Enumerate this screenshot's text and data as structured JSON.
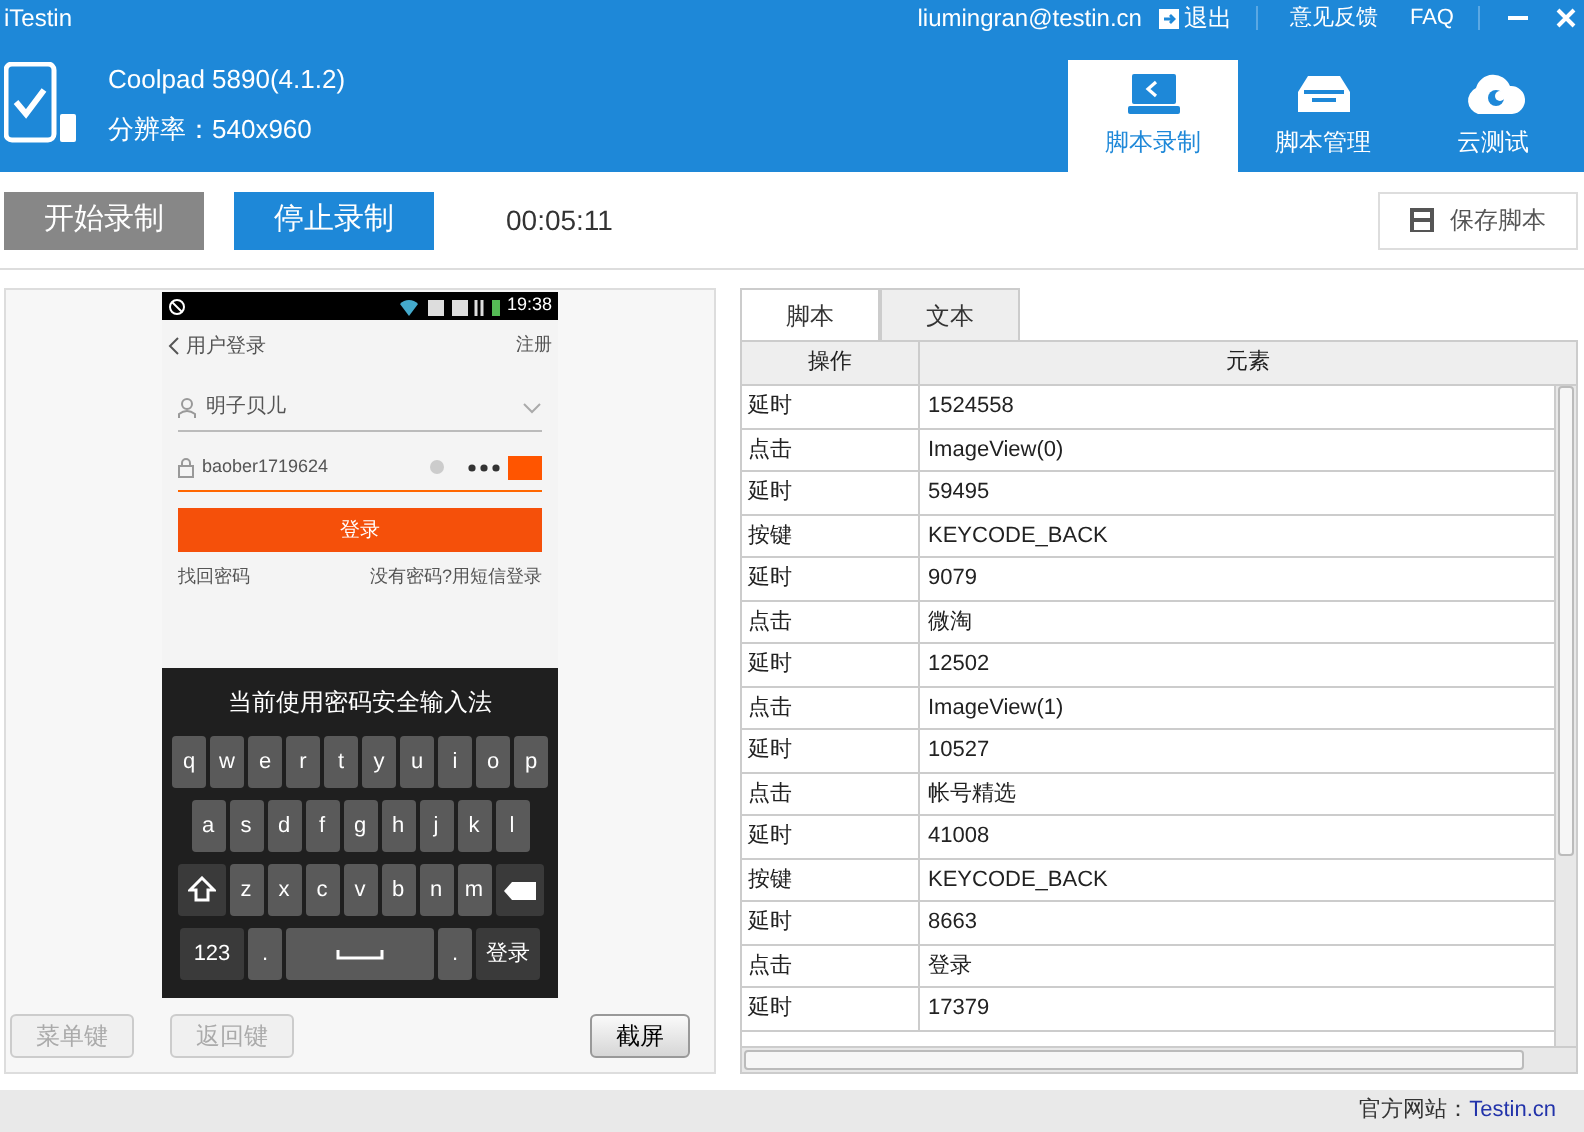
{
  "window": {
    "title": "iTestin",
    "user": "liumingran@testin.cn",
    "logout": "退出",
    "links": [
      "意见反馈",
      "FAQ"
    ]
  },
  "device": {
    "name": "Coolpad 5890(4.1.2)",
    "resolution": "分辨率：540x960"
  },
  "nav_tabs": [
    {
      "label": "脚本录制",
      "kind": "monitor",
      "selected": true
    },
    {
      "label": "脚本管理",
      "kind": "tray",
      "selected": false
    },
    {
      "label": "云测试",
      "kind": "cloud",
      "selected": false
    }
  ],
  "toolbar": {
    "start": {
      "label": "开始录制",
      "disabled": true
    },
    "stop": {
      "label": "停止录制",
      "disabled": false
    },
    "timer": "00:05:11",
    "save": "保存脚本"
  },
  "phone": {
    "time": "19:38",
    "title": "用户登录",
    "register": "注册",
    "username": "明子贝儿",
    "password": "baober1719624",
    "login": "登录",
    "forgot": "找回密码",
    "sms": "没有密码?用短信登录",
    "keyboard": {
      "title": "当前使用密码安全输入法",
      "rows": [
        {
          "keys": [
            {
              "kind": "key",
              "label": "q"
            },
            {
              "kind": "key",
              "label": "w"
            },
            {
              "kind": "key",
              "label": "e"
            },
            {
              "kind": "key",
              "label": "r"
            },
            {
              "kind": "key",
              "label": "t"
            },
            {
              "kind": "key",
              "label": "y"
            },
            {
              "kind": "key",
              "label": "u"
            },
            {
              "kind": "key",
              "label": "i"
            },
            {
              "kind": "key",
              "label": "o"
            },
            {
              "kind": "key",
              "label": "p"
            }
          ]
        },
        {
          "keys": [
            {
              "kind": "key",
              "label": "a"
            },
            {
              "kind": "key",
              "label": "s"
            },
            {
              "kind": "key",
              "label": "d"
            },
            {
              "kind": "key",
              "label": "f"
            },
            {
              "kind": "key",
              "label": "g"
            },
            {
              "kind": "key",
              "label": "h"
            },
            {
              "kind": "key",
              "label": "j"
            },
            {
              "kind": "key",
              "label": "k"
            },
            {
              "kind": "key",
              "label": "l"
            }
          ]
        },
        {
          "keys": [
            {
              "kind": "shift"
            },
            {
              "kind": "key",
              "label": "z"
            },
            {
              "kind": "key",
              "label": "x"
            },
            {
              "kind": "key",
              "label": "c"
            },
            {
              "kind": "key",
              "label": "v"
            },
            {
              "kind": "key",
              "label": "b"
            },
            {
              "kind": "key",
              "label": "n"
            },
            {
              "kind": "key",
              "label": "m"
            },
            {
              "kind": "backspace"
            }
          ]
        },
        {
          "keys": [
            {
              "kind": "wide",
              "label": "123"
            },
            {
              "kind": "key",
              "label": "."
            },
            {
              "kind": "space"
            },
            {
              "kind": "key",
              "label": "."
            },
            {
              "kind": "wide",
              "label": "登录"
            }
          ]
        }
      ]
    }
  },
  "phone_buttons": [
    {
      "label": "菜单键",
      "disabled": true
    },
    {
      "label": "返回键",
      "disabled": true
    },
    {
      "label": "截屏",
      "disabled": false
    }
  ],
  "script_tabs": [
    {
      "label": "脚本",
      "selected": true
    },
    {
      "label": "文本",
      "selected": false
    }
  ],
  "table": {
    "columns": [
      "操作",
      "元素"
    ],
    "rows": [
      [
        "延时",
        "1524558"
      ],
      [
        "点击",
        "ImageView(0)"
      ],
      [
        "延时",
        "59495"
      ],
      [
        "按键",
        "KEYCODE_BACK"
      ],
      [
        "延时",
        "9079"
      ],
      [
        "点击",
        "微淘"
      ],
      [
        "延时",
        "12502"
      ],
      [
        "点击",
        "ImageView(1)"
      ],
      [
        "延时",
        "10527"
      ],
      [
        "点击",
        "帐号精选"
      ],
      [
        "延时",
        "41008"
      ],
      [
        "按键",
        "KEYCODE_BACK"
      ],
      [
        "延时",
        "8663"
      ],
      [
        "点击",
        "登录"
      ],
      [
        "延时",
        "17379"
      ]
    ]
  },
  "status_bar": {
    "label": "官方网站：",
    "link": "Testin.cn"
  }
}
